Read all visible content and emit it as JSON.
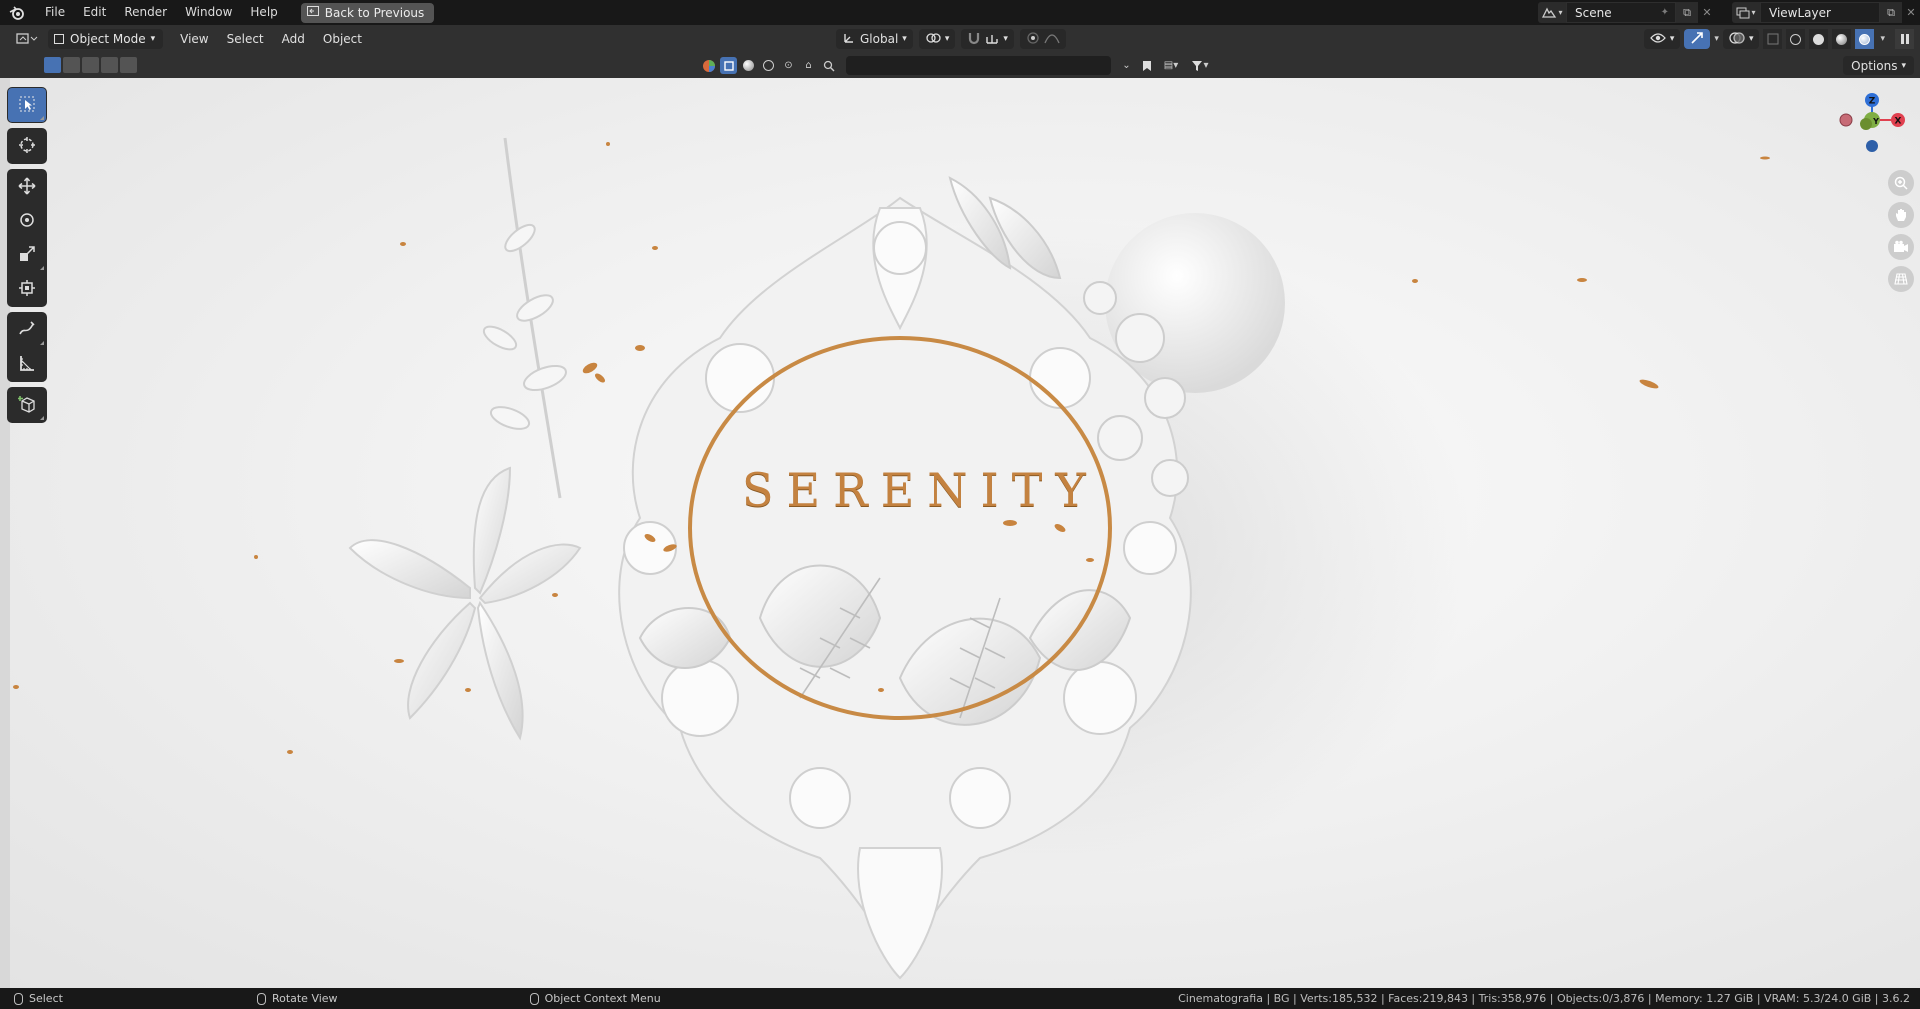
{
  "top_menu": {
    "items": [
      "File",
      "Edit",
      "Render",
      "Window",
      "Help"
    ],
    "back_button": "Back to Previous"
  },
  "top_right": {
    "scene_name": "Scene",
    "view_layer_name": "ViewLayer"
  },
  "header": {
    "mode": "Object Mode",
    "menus": [
      "View",
      "Select",
      "Add",
      "Object"
    ],
    "orientation": "Global"
  },
  "toolheader": {
    "options_label": "Options"
  },
  "scene": {
    "title_text": "SERENITY"
  },
  "gizmo": {
    "z_label": "Z",
    "y_label": "Y",
    "x_label": "X",
    "colors": {
      "x": "#e0404f",
      "y": "#8bc34a",
      "z": "#2f6fd6"
    }
  },
  "status_bar": {
    "left_items": [
      "Select",
      "Rotate View",
      "Object Context Menu"
    ],
    "stats": "Cinematografia | BG | Verts:185,532 | Faces:219,843 | Tris:358,976 | Objects:0/3,876 | Memory: 1.27 GiB | VRAM: 5.3/24.0 GiB | 3.6.2"
  }
}
